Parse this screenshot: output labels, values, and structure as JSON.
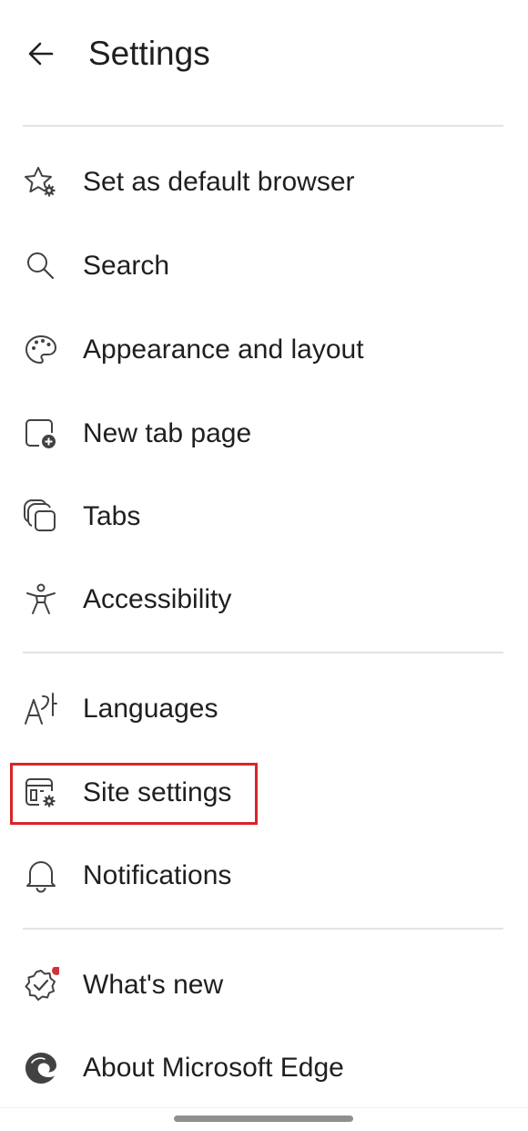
{
  "header": {
    "title": "Settings",
    "back_icon": "arrow-left-icon"
  },
  "sections": [
    {
      "items": [
        {
          "label": "Set as default browser",
          "icon": "star-gear-icon"
        },
        {
          "label": "Search",
          "icon": "search-icon"
        },
        {
          "label": "Appearance and layout",
          "icon": "palette-icon"
        },
        {
          "label": "New tab page",
          "icon": "new-tab-icon"
        },
        {
          "label": "Tabs",
          "icon": "tabs-icon"
        },
        {
          "label": "Accessibility",
          "icon": "accessibility-icon"
        }
      ]
    },
    {
      "items": [
        {
          "label": "Languages",
          "icon": "languages-icon"
        },
        {
          "label": "Site settings",
          "icon": "site-settings-icon",
          "highlighted": true
        },
        {
          "label": "Notifications",
          "icon": "bell-icon"
        }
      ]
    },
    {
      "items": [
        {
          "label": "What's new",
          "icon": "badge-check-icon",
          "has_dot": true
        },
        {
          "label": "About Microsoft Edge",
          "icon": "edge-logo-icon"
        }
      ]
    }
  ],
  "colors": {
    "text": "#1f1f1f",
    "icon": "#424242",
    "divider": "#e3e3e3",
    "highlight": "#d9242b",
    "notification_dot": "#d13438"
  }
}
